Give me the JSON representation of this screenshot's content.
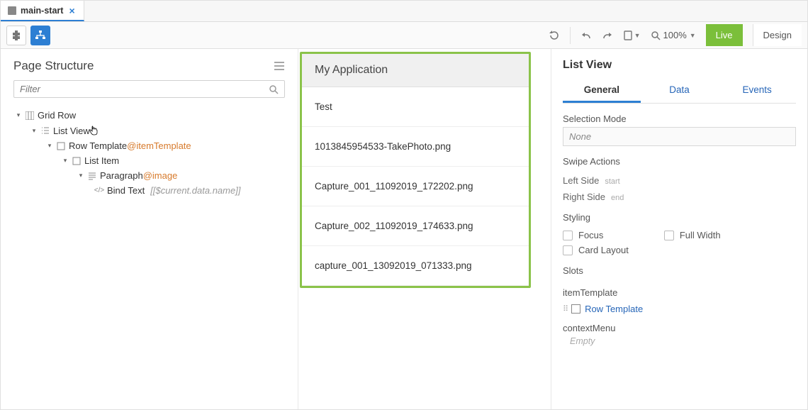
{
  "tab": {
    "name": "main-start"
  },
  "toolbar": {
    "zoom": "100%",
    "live": "Live",
    "design": "Design"
  },
  "left": {
    "title": "Page Structure",
    "filter_placeholder": "Filter",
    "tree": {
      "gridrow": "Grid Row",
      "listview": "List View",
      "rowtemplate": "Row Template",
      "rowtemplate_suffix": "@itemTemplate",
      "listitem": "List Item",
      "paragraph": "Paragraph",
      "paragraph_suffix": "@image",
      "bindtext": "Bind Text",
      "bindtext_expr": "[[$current.data.name]]"
    }
  },
  "canvas": {
    "appTitle": "My Application",
    "items": [
      "Test",
      "1013845954533-TakePhoto.png",
      "Capture_001_11092019_172202.png",
      "Capture_002_11092019_174633.png",
      "capture_001_13092019_071333.png"
    ]
  },
  "right": {
    "title": "List View",
    "tabs": {
      "general": "General",
      "data": "Data",
      "events": "Events"
    },
    "selectionMode": {
      "label": "Selection Mode",
      "value": "None"
    },
    "swipe": {
      "label": "Swipe Actions",
      "left": "Left Side",
      "leftTag": "start",
      "right": "Right Side",
      "rightTag": "end"
    },
    "styling": {
      "label": "Styling",
      "focus": "Focus",
      "fullwidth": "Full Width",
      "card": "Card Layout"
    },
    "slots": {
      "label": "Slots",
      "itemTemplate": "itemTemplate",
      "rowTemplate": "Row Template",
      "contextMenu": "contextMenu",
      "empty": "Empty"
    }
  }
}
